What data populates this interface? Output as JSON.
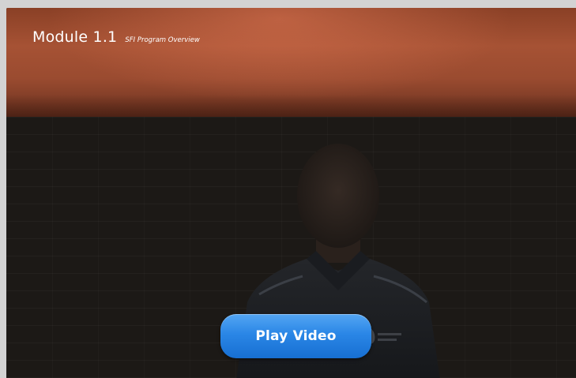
{
  "header": {
    "title": "Module 1.1",
    "subtitle": "SFI Program Overview"
  },
  "video": {
    "play_label": "Play Video"
  },
  "icons": {
    "shirt_logo": "logo-emblem-icon"
  },
  "colors": {
    "header_accent": "#a65234",
    "button": "#2a86e6"
  }
}
